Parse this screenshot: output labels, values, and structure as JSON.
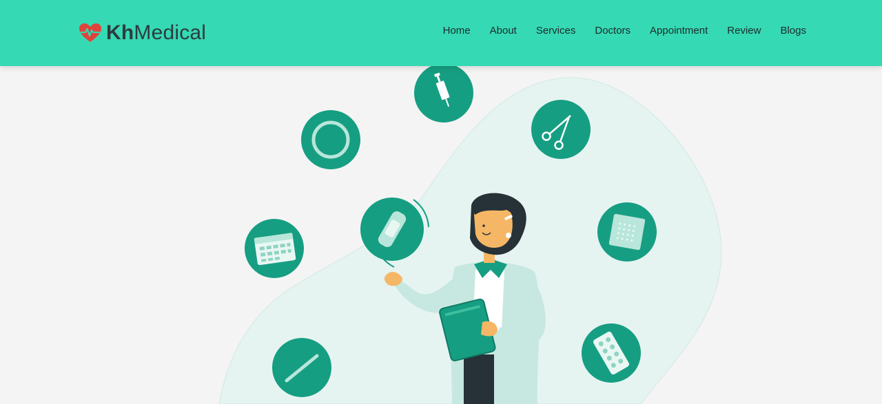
{
  "brand": {
    "name_bold": "Kh",
    "name_regular": "Medical"
  },
  "nav": [
    {
      "label": "Home"
    },
    {
      "label": "About"
    },
    {
      "label": "Services"
    },
    {
      "label": "Doctors"
    },
    {
      "label": "Appointment"
    },
    {
      "label": "Review"
    },
    {
      "label": "Blogs"
    }
  ],
  "icons": [
    "syringe-icon",
    "scissors-icon",
    "ring-icon",
    "calendar-icon",
    "bandage-icon",
    "plaster-icon",
    "pill-blister-icon",
    "thermometer-icon"
  ],
  "colors": {
    "header": "#35d9b3",
    "icon_circle": "#169e82",
    "blob": "#e6f4f1",
    "heart": "#e0433a"
  }
}
